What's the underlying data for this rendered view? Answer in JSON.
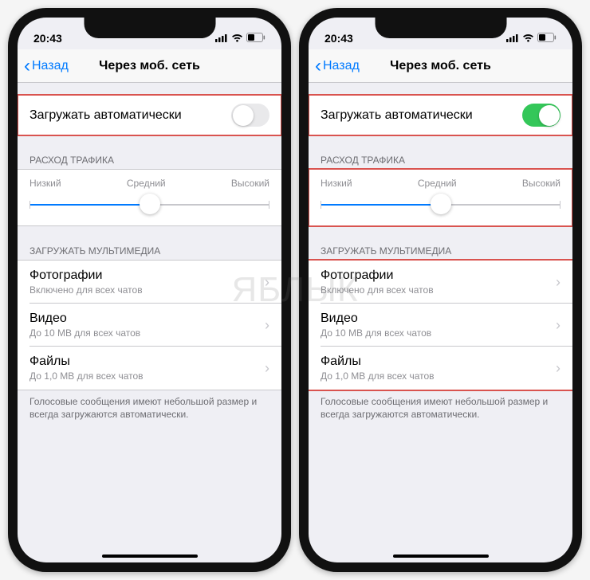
{
  "status": {
    "time": "20:43"
  },
  "nav": {
    "back": "Назад",
    "title": "Через моб. сеть"
  },
  "auto": {
    "label": "Загружать автоматически"
  },
  "traffic": {
    "header": "РАСХОД ТРАФИКА",
    "low": "Низкий",
    "mid": "Средний",
    "high": "Высокий"
  },
  "media": {
    "header": "ЗАГРУЖАТЬ МУЛЬТИМЕДИА",
    "photos": {
      "title": "Фотографии",
      "sub": "Включено для всех чатов"
    },
    "videos": {
      "title": "Видео",
      "sub": "До 10 MB для всех чатов"
    },
    "files": {
      "title": "Файлы",
      "sub": "До 1,0 MB для всех чатов"
    },
    "footer": "Голосовые сообщения имеют небольшой размер и всегда загружаются автоматически."
  },
  "watermark": "ЯБЛЫК"
}
